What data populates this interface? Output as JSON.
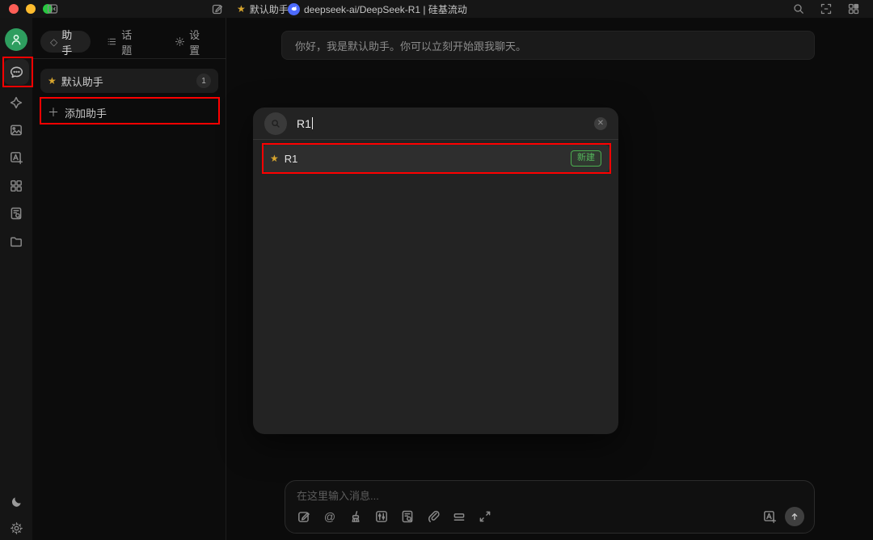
{
  "titlebar": {
    "assistant_label": "默认助手",
    "model_label": "deepseek-ai/DeepSeek-R1 | 硅基流动"
  },
  "sidebar": {
    "icons": [
      "user-avatar",
      "chat",
      "sparkle-translate",
      "image-generation",
      "agent-add",
      "minapps-grid",
      "knowledge-search",
      "files-folder",
      "dark-mode-moon",
      "settings-gear"
    ]
  },
  "assistants_panel": {
    "tabs": [
      {
        "label": "助手"
      },
      {
        "label": "话题"
      },
      {
        "label": "设置"
      }
    ],
    "items": [
      {
        "label": "默认助手",
        "count": "1"
      }
    ],
    "add_assistant_label": "添加助手"
  },
  "chat": {
    "greeting": "你好，我是默认助手。你可以立刻开始跟我聊天。",
    "input_placeholder": "在这里输入消息..."
  },
  "model_search": {
    "query": "R1",
    "results": [
      {
        "label": "R1",
        "badge": "新建"
      }
    ]
  },
  "symbols": {
    "star": "★",
    "plus": "＋",
    "at": "@",
    "close": "✕"
  },
  "colors": {
    "annotation_red": "#ff0000",
    "avatar_green": "#2e9e5f",
    "badge_green": "#4caf50",
    "star_gold": "#d9a62e",
    "deepseek_blue": "#4d6bfe",
    "traffic_red": "#ff5f57",
    "traffic_yellow": "#febc2e",
    "traffic_green": "#28c840"
  }
}
